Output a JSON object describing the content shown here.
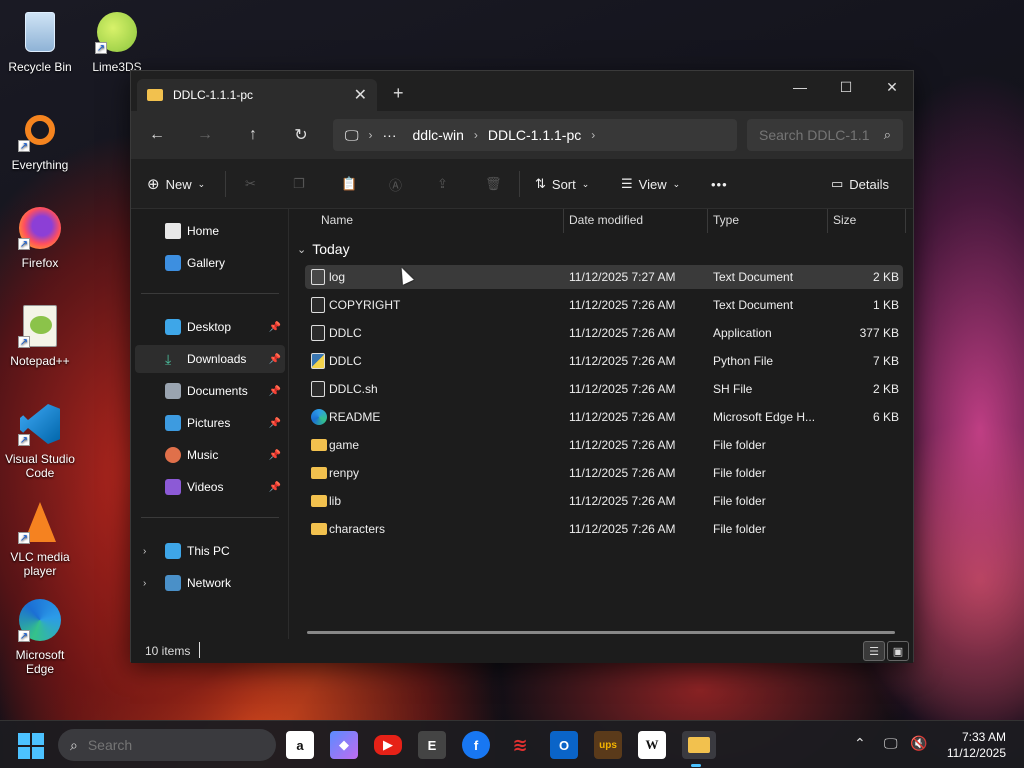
{
  "desktop": {
    "icons": [
      {
        "label": "Recycle Bin",
        "icon": "recycle-bin-icon"
      },
      {
        "label": "Lime3DS",
        "icon": "lime-icon"
      },
      {
        "label": "Everything",
        "icon": "magnifier-icon"
      },
      {
        "label": "Firefox",
        "icon": "firefox-icon"
      },
      {
        "label": "Notepad++",
        "icon": "notepadpp-icon"
      },
      {
        "label": "Visual Studio Code",
        "icon": "vscode-icon"
      },
      {
        "label": "VLC media player",
        "icon": "vlc-cone-icon"
      },
      {
        "label": "Microsoft Edge",
        "icon": "edge-icon"
      }
    ]
  },
  "window": {
    "tab_title": "DDLC-1.1.1-pc",
    "newtab_label": "+",
    "address": {
      "overflow": "···",
      "parts": [
        "ddlc-win",
        "DDLC-1.1.1-pc"
      ]
    },
    "search_placeholder": "Search DDLC-1.1",
    "toolbar": {
      "new_label": "New",
      "sort_label": "Sort",
      "view_label": "View",
      "more_label": "•••",
      "details_label": "Details"
    },
    "sidebar": {
      "home": "Home",
      "gallery": "Gallery",
      "pinned": [
        {
          "label": "Desktop"
        },
        {
          "label": "Downloads"
        },
        {
          "label": "Documents"
        },
        {
          "label": "Pictures"
        },
        {
          "label": "Music"
        },
        {
          "label": "Videos"
        }
      ],
      "this_pc": "This PC",
      "network": "Network"
    },
    "columns": {
      "name": "Name",
      "date": "Date modified",
      "type": "Type",
      "size": "Size"
    },
    "group_label": "Today",
    "files": [
      {
        "name": "log",
        "date": "11/12/2025 7:27 AM",
        "type": "Text Document",
        "size": "2 KB",
        "icon": "text-file-icon"
      },
      {
        "name": "COPYRIGHT",
        "date": "11/12/2025 7:26 AM",
        "type": "Text Document",
        "size": "1 KB",
        "icon": "text-file-icon"
      },
      {
        "name": "DDLC",
        "date": "11/12/2025 7:26 AM",
        "type": "Application",
        "size": "377 KB",
        "icon": "app-file-icon"
      },
      {
        "name": "DDLC",
        "date": "11/12/2025 7:26 AM",
        "type": "Python File",
        "size": "7 KB",
        "icon": "python-file-icon"
      },
      {
        "name": "DDLC.sh",
        "date": "11/12/2025 7:26 AM",
        "type": "SH File",
        "size": "2 KB",
        "icon": "file-icon"
      },
      {
        "name": "README",
        "date": "11/12/2025 7:26 AM",
        "type": "Microsoft Edge H...",
        "size": "6 KB",
        "icon": "edge-file-icon"
      },
      {
        "name": "game",
        "date": "11/12/2025 7:26 AM",
        "type": "File folder",
        "size": "",
        "icon": "folder-icon"
      },
      {
        "name": "renpy",
        "date": "11/12/2025 7:26 AM",
        "type": "File folder",
        "size": "",
        "icon": "folder-icon"
      },
      {
        "name": "lib",
        "date": "11/12/2025 7:26 AM",
        "type": "File folder",
        "size": "",
        "icon": "folder-icon"
      },
      {
        "name": "characters",
        "date": "11/12/2025 7:26 AM",
        "type": "File folder",
        "size": "",
        "icon": "folder-icon"
      }
    ],
    "status": {
      "count": "10 items"
    }
  },
  "taskbar": {
    "search_placeholder": "Search",
    "apps": [
      "amazon-icon",
      "copilot-icon",
      "youtube-icon",
      "epic-games-icon",
      "facebook-icon",
      "app-red-icon",
      "outlook-icon",
      "ups-icon",
      "wikipedia-icon",
      "file-explorer-icon"
    ],
    "time": "7:33 AM",
    "date": "11/12/2025"
  },
  "colors": {
    "accent": "#4cc2ff",
    "folder": "#f2c14e",
    "selection": "#3a3a3a"
  }
}
